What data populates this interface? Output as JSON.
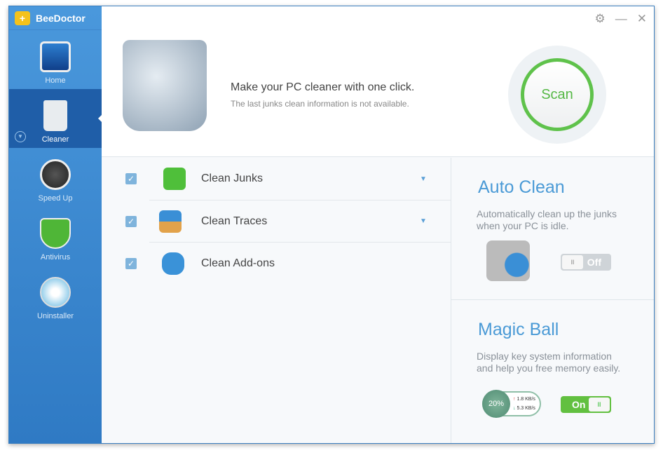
{
  "app": {
    "title": "BeeDoctor"
  },
  "sidebar": {
    "items": [
      {
        "label": "Home"
      },
      {
        "label": "Cleaner"
      },
      {
        "label": "Speed Up"
      },
      {
        "label": "Antivirus"
      },
      {
        "label": "Uninstaller"
      }
    ]
  },
  "header": {
    "headline": "Make your PC cleaner with one click.",
    "sub": "The last junks clean information is not available.",
    "scan": "Scan"
  },
  "list": [
    {
      "label": "Clean Junks",
      "checked": true
    },
    {
      "label": "Clean Traces",
      "checked": true
    },
    {
      "label": "Clean Add-ons",
      "checked": true
    }
  ],
  "auto_clean": {
    "title": "Auto Clean",
    "desc": "Automatically clean up the junks when your PC is idle.",
    "toggle": "Off"
  },
  "magic_ball": {
    "title": "Magic Ball",
    "desc": "Display key system information and help you free memory easily.",
    "toggle": "On",
    "percent": "20%",
    "up": "1.8 KB/s",
    "down": "5.3 KB/s"
  },
  "colors": {
    "accent": "#4a9ad6",
    "green": "#62c040"
  }
}
